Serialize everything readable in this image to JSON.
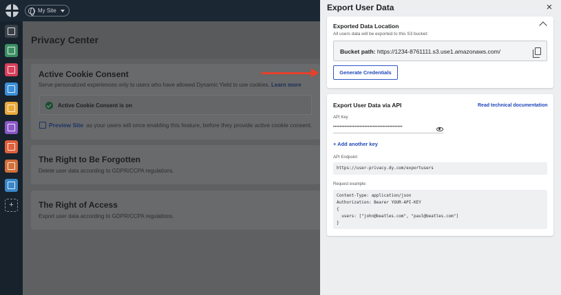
{
  "topbar": {
    "site_label": "My Site"
  },
  "sidebar": {
    "icons": [
      {
        "name": "dashboard-icon",
        "color": "#3a4048"
      },
      {
        "name": "audience-icon",
        "color": "#3c8f63"
      },
      {
        "name": "campaign-icon",
        "color": "#d6405a"
      },
      {
        "name": "content-icon",
        "color": "#3c8fd6"
      },
      {
        "name": "email-icon",
        "color": "#e8a93c"
      },
      {
        "name": "analytics-icon",
        "color": "#8a58c7"
      },
      {
        "name": "experience-icon",
        "color": "#e0613b"
      },
      {
        "name": "recommendations-icon",
        "color": "#d4703a"
      },
      {
        "name": "layers-icon",
        "color": "#3a86c8"
      }
    ],
    "add_label": "+"
  },
  "page": {
    "title": "Privacy Center",
    "cookie_card": {
      "title": "Active Cookie Consent",
      "subtitle": "Serve personalized experiences only to users who have allowed Dynamic Yield to use cookies.",
      "learn_more": "Learn more",
      "status": "Active Cookie Consent is on",
      "preview_link": "Preview Site",
      "preview_text": "as your users will once enabling this feature, before they provide active cookie consent."
    },
    "forgotten_card": {
      "title": "The Right to Be Forgotten",
      "subtitle": "Delete user data according to GDPR/CCPA regulations."
    },
    "access_card": {
      "title": "The Right of Access",
      "subtitle": "Export user data according to GDPR/CCPA regulations."
    }
  },
  "drawer": {
    "title": "Export User Data",
    "close_label": "×",
    "location": {
      "title": "Exported Data Location",
      "subtitle": "All users data will be exported to this S3 bucket:",
      "bucket_label": "Bucket path:",
      "bucket_path": "https://1234-8761111.s3.use1.amazonaws.com/",
      "generate_button": "Generate Credentials"
    },
    "api": {
      "title": "Export User Data via API",
      "doc_link": "Read technical documentation",
      "key_label": "API Key",
      "key_value": "••••••••••••••••••••••••••••••••••••••••••",
      "add_key": "+ Add another key",
      "endpoint_label": "API Endpoint",
      "endpoint": "https://user-privacy.dy.com/exportusers",
      "request_label": "Request example:",
      "request_lines": [
        "Content-Type: application/json",
        "Authorization: Bearer YOUR-API-KEY",
        "{",
        "  users: [\"john@beatles.com\", \"paul@beatles.com\"]",
        "}"
      ]
    }
  }
}
